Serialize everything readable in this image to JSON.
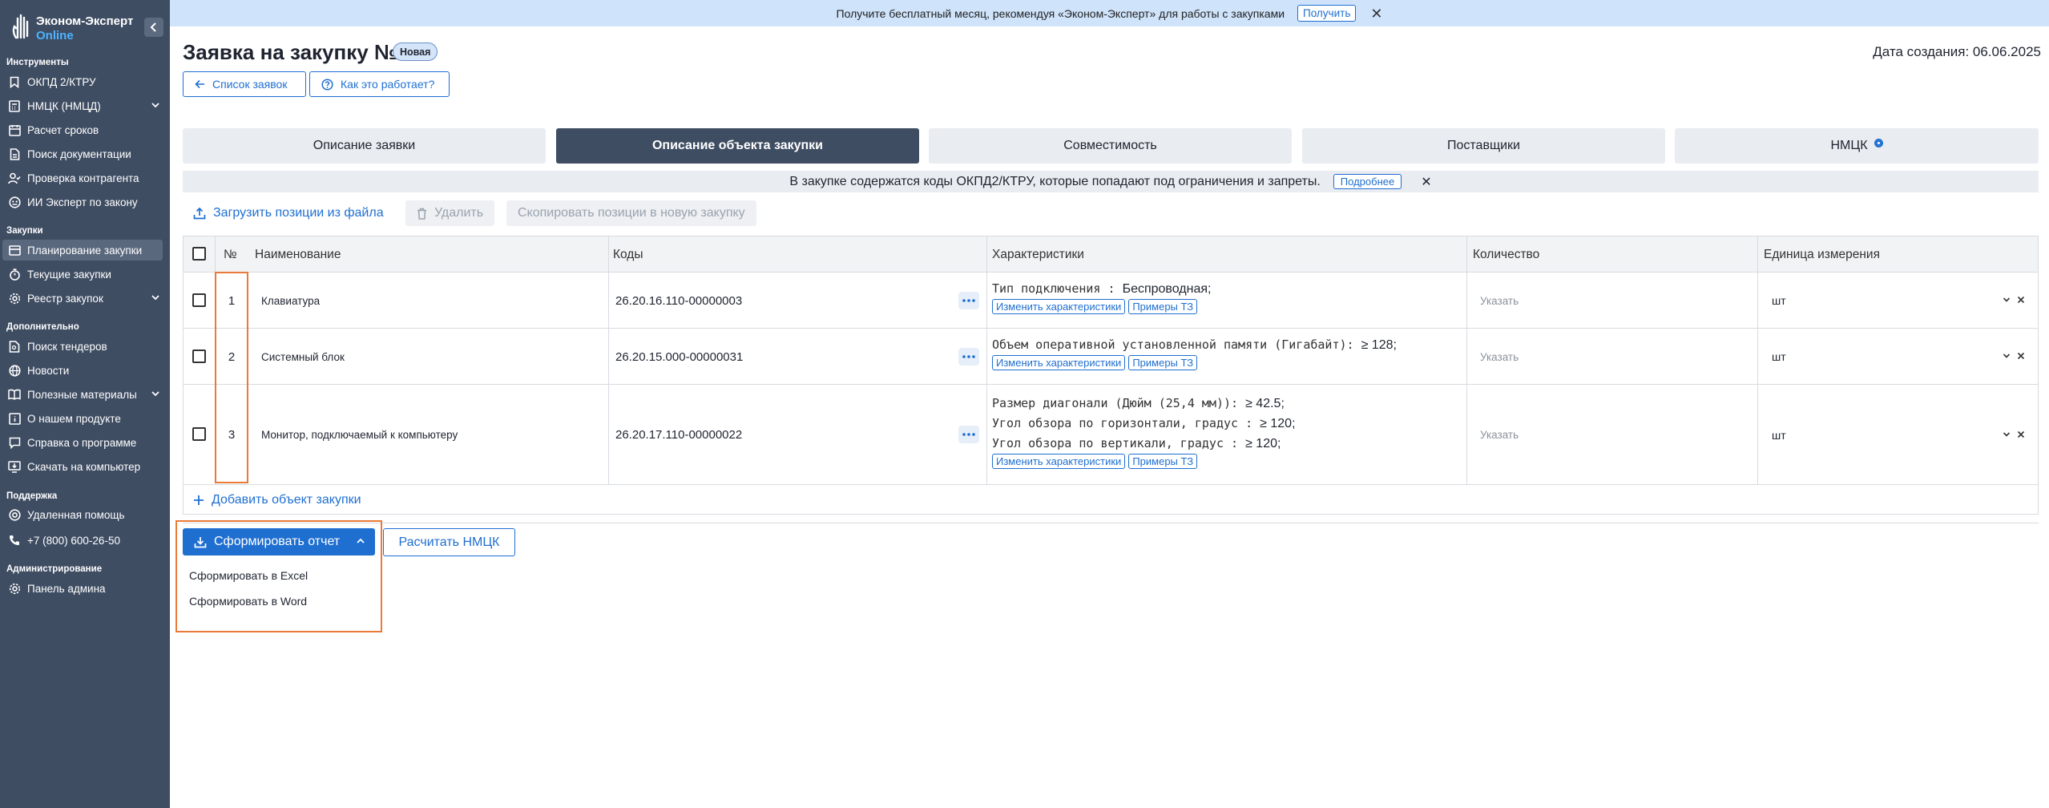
{
  "sidebar": {
    "logo": {
      "name": "Эконом-Эксперт",
      "sub": "Online"
    },
    "sections": {
      "tools": "Инструменты",
      "purchases": "Закупки",
      "extra": "Дополнительно",
      "support": "Поддержка",
      "admin": "Администрирование"
    },
    "items": {
      "okpd": "ОКПД 2/КТРУ",
      "nmck": "НМЦК (НМЦД)",
      "deadlines": "Расчет сроков",
      "docs": "Поиск документации",
      "counterparty": "Проверка контрагента",
      "ai_expert": "ИИ Эксперт по закону",
      "planning": "Планирование закупки",
      "current": "Текущие закупки",
      "registry": "Реестр закупок",
      "tenders": "Поиск тендеров",
      "news": "Новости",
      "materials": "Полезные материалы",
      "about": "О нашем продукте",
      "help": "Справка о программе",
      "download": "Скачать на компьютер",
      "remote": "Удаленная помощь",
      "phone": "+7 (800) 600-26-50",
      "admin_panel": "Панель админа"
    }
  },
  "banner": {
    "text": "Получите бесплатный месяц, рекомендуя «Эконом-Эксперт» для работы с закупками",
    "button": "Получить",
    "close": "✕"
  },
  "header": {
    "title": "Заявка на закупку №2",
    "status": "Новая",
    "created": "Дата создания: 06.06.2025",
    "back_button": "Список заявок",
    "help_button": "Как это работает?"
  },
  "tabs": [
    {
      "label": "Описание заявки"
    },
    {
      "label": "Описание объекта закупки"
    },
    {
      "label": "Совместимость"
    },
    {
      "label": "Поставщики"
    },
    {
      "label": "НМЦК"
    }
  ],
  "notice": {
    "text": "В закупке содержатся коды ОКПД2/КТРУ, которые попадают под ограничения и запреты.",
    "button": "Подробнее",
    "close": "✕"
  },
  "toolbar": {
    "upload": "Загрузить позиции из файла",
    "delete": "Удалить",
    "copy": "Скопировать позиции в новую закупку"
  },
  "table": {
    "headers": {
      "num": "№",
      "name": "Наименование",
      "codes": "Коды",
      "chars": "Характеристики",
      "qty": "Количество",
      "unit": "Единица измерения"
    },
    "edit_chars": "Изменить характеристики",
    "examples": "Примеры ТЗ",
    "rows": [
      {
        "num": "1",
        "name": "Клавиатура",
        "code": "26.20.16.110-00000003",
        "chars": [
          {
            "label": "Тип подключения : ",
            "value": "Беспроводная;"
          }
        ],
        "qty": "Указать",
        "unit": "шт"
      },
      {
        "num": "2",
        "name": "Системный блок",
        "code": "26.20.15.000-00000031",
        "chars": [
          {
            "label": "Объем оперативной установленной памяти (Гигабайт): ",
            "value": "≥ 128;"
          }
        ],
        "qty": "Указать",
        "unit": "шт"
      },
      {
        "num": "3",
        "name": "Монитор, подключаемый к компьютеру",
        "code": "26.20.17.110-00000022",
        "chars": [
          {
            "label": "Размер диагонали (Дюйм (25,4 мм)): ",
            "value": "≥ 42.5;"
          },
          {
            "label": "Угол обзора по горизонтали, градус : ",
            "value": "≥ 120;"
          },
          {
            "label": "Угол обзора по вертикали, градус : ",
            "value": "≥ 120;"
          }
        ],
        "qty": "Указать",
        "unit": "шт"
      }
    ],
    "add_row": "Добавить объект закупки"
  },
  "actions": {
    "report": "Сформировать отчет",
    "calc": "Расчитать НМЦК",
    "menu": [
      "Сформировать в Excel",
      "Сформировать в Word"
    ]
  },
  "colors": {
    "sidebar": "#3f4d63",
    "accent": "#1f6fd1",
    "highlight": "#ea7a3a",
    "banner": "#cfe3fb"
  }
}
